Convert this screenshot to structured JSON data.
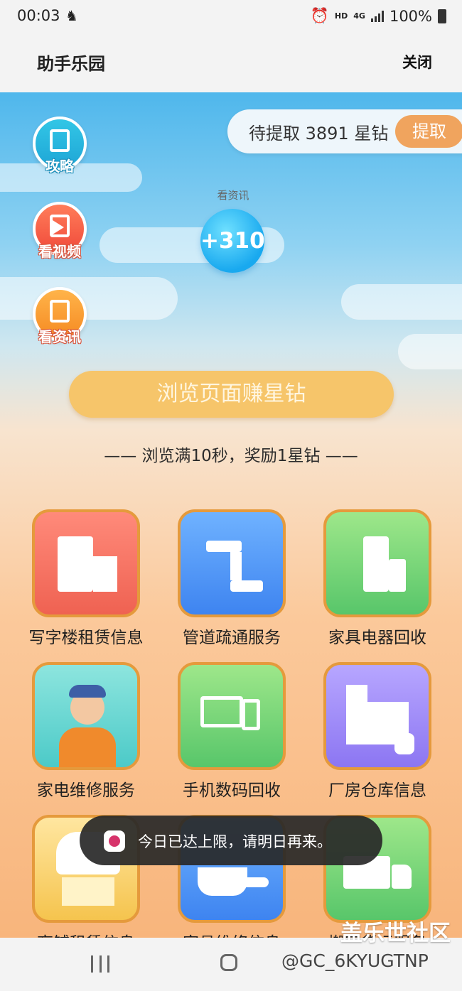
{
  "status_bar": {
    "time": "00:03",
    "network": "HD",
    "gen": "4G",
    "battery": "100%"
  },
  "header": {
    "title": "助手乐园",
    "close_label": "关闭"
  },
  "withdraw": {
    "text": "待提取 3891 星钻",
    "button_label": "提取"
  },
  "side_buttons": [
    {
      "label": "攻略",
      "icon": "book-icon"
    },
    {
      "label": "看视频",
      "icon": "video-play-icon"
    },
    {
      "label": "看资讯",
      "icon": "news-doc-icon"
    }
  ],
  "reward": {
    "label": "看资讯",
    "value": "+310"
  },
  "browse": {
    "button_label": "浏览页面赚星钻",
    "rule_text": "—— 浏览满10秒，奖励1星钻 ——"
  },
  "grid": [
    {
      "label": "写字楼租赁信息",
      "icon": "office-building-icon",
      "color": "#ef6252"
    },
    {
      "label": "管道疏通服务",
      "icon": "pipe-icon",
      "color": "#3e84f0"
    },
    {
      "label": "家具电器回收",
      "icon": "fridge-recycle-icon",
      "color": "#58c66a"
    },
    {
      "label": "家电维修服务",
      "icon": "repairman-icon",
      "color": "#4ccac8"
    },
    {
      "label": "手机数码回收",
      "icon": "devices-recycle-icon",
      "color": "#58c66a"
    },
    {
      "label": "厂房仓库信息",
      "icon": "factory-icon",
      "color": "#8c76f2"
    },
    {
      "label": "商铺租赁信息",
      "icon": "shop-icon",
      "color": "#f5c44e"
    },
    {
      "label": "家具维修信息",
      "icon": "tools-icon",
      "color": "#3e84f0"
    },
    {
      "label": "搬家货运服务",
      "icon": "truck-icon",
      "color": "#58c66a"
    }
  ],
  "toast": {
    "message": "今日已达上限，请明日再来。"
  },
  "watermark": {
    "site": "盖乐世社区",
    "user": "@GC_6KYUGTNP"
  }
}
